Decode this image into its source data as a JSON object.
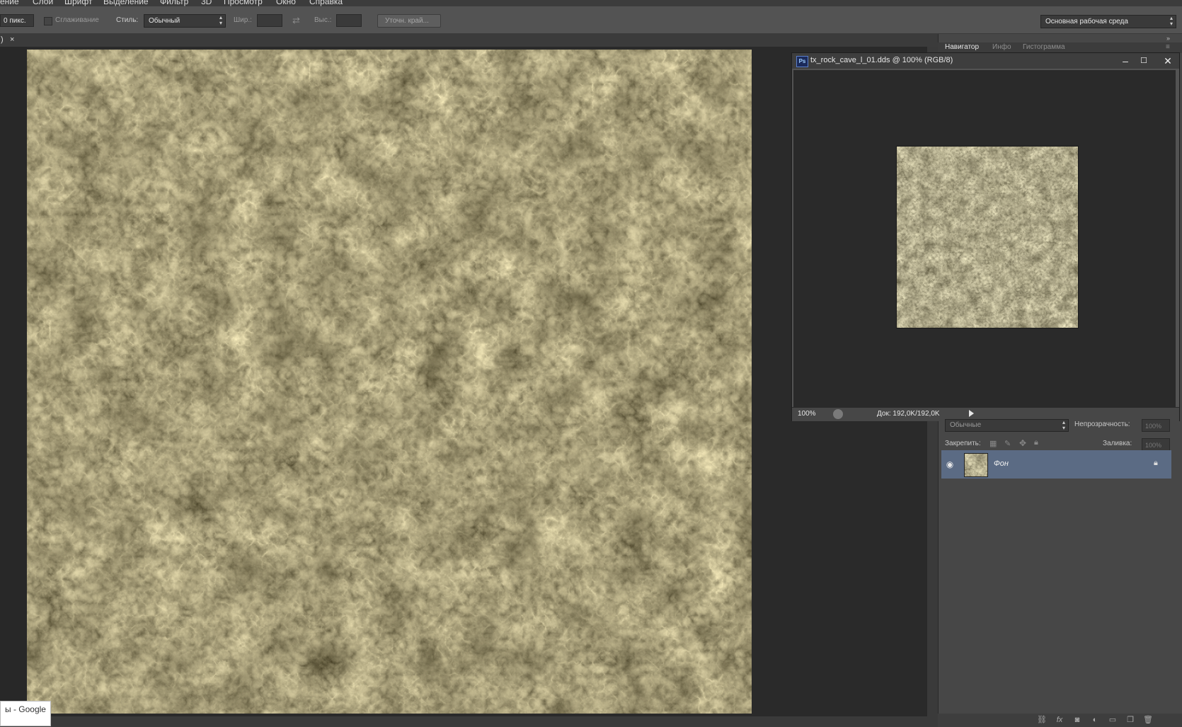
{
  "menu": {
    "items": [
      "ение",
      "Слои",
      "Шрифт",
      "Выделение",
      "Фильтр",
      "3D",
      "Просмотр",
      "Окно",
      "Справка"
    ]
  },
  "options": {
    "feather_value": "0 пикс.",
    "antialias_label": "Сглаживание",
    "style_label": "Стиль:",
    "style_value": "Обычный",
    "width_label": "Шир.:",
    "height_label": "Выс.:",
    "refine_edge_button": "Уточн. край...",
    "workspace_value": "Основная рабочая среда"
  },
  "tabstrip": {
    "close_glyph": "×",
    "left_fragment": ")"
  },
  "panels": {
    "tabs": [
      "Навигатор",
      "Инфо",
      "Гистограмма"
    ]
  },
  "navigator_window": {
    "title": "tx_rock_cave_l_01.dds @ 100% (RGB/8)",
    "ps_badge": "Ps",
    "zoom": "100%",
    "doc_size": "Док: 192,0K/192,0K"
  },
  "layers": {
    "blend_mode": "Обычные",
    "opacity_label": "Непрозрачность:",
    "opacity_value": "100%",
    "lock_label": "Закрепить:",
    "fill_label": "Заливка:",
    "fill_value": "100%",
    "layer_name": "Фон"
  },
  "tooltip": {
    "text": "ы - Google"
  },
  "icons": [
    "link-layers-icon",
    "fx-icon",
    "mask-icon",
    "adjustment-icon",
    "folder-icon",
    "new-layer-icon",
    "trash-icon"
  ],
  "colors": {
    "panel_bg": "#474747",
    "canvas_bg": "#2a2a2a",
    "selected_layer": "#5b6b84"
  }
}
